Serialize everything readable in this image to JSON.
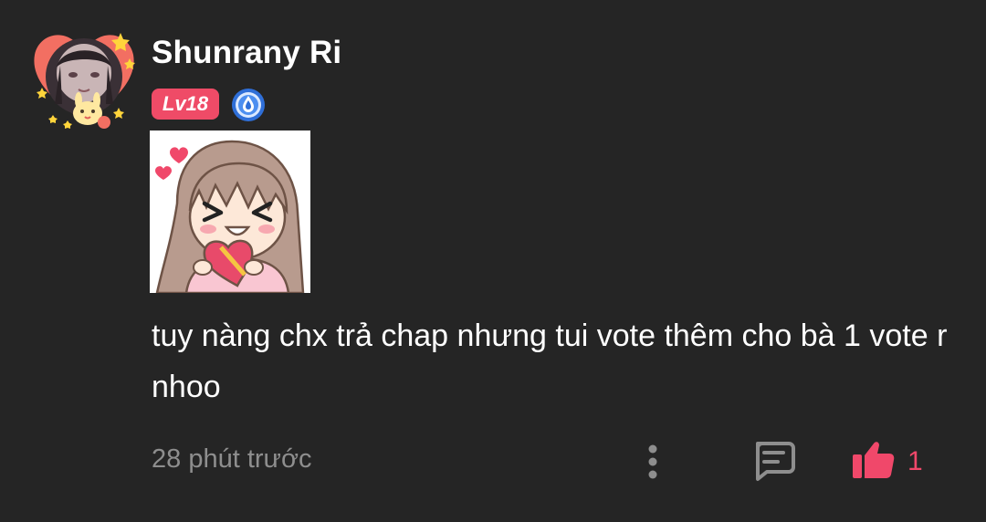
{
  "user": {
    "name": "Shunrany Ri",
    "level": "Lv18"
  },
  "comment": {
    "text": "tuy nàng chx trả chap nhưng tui vote thêm cho bà 1 vote r nhoo",
    "time": "28 phút trước"
  },
  "actions": {
    "like_count": "1"
  },
  "icons": {
    "more": "more-vertical-icon",
    "reply": "comment-icon",
    "like": "thumbs-up-icon",
    "rank": "droplet-rank-icon"
  },
  "colors": {
    "background": "#252525",
    "accent": "#f0486a",
    "level_badge": "#ef4b67",
    "muted": "#8e8e8e"
  }
}
